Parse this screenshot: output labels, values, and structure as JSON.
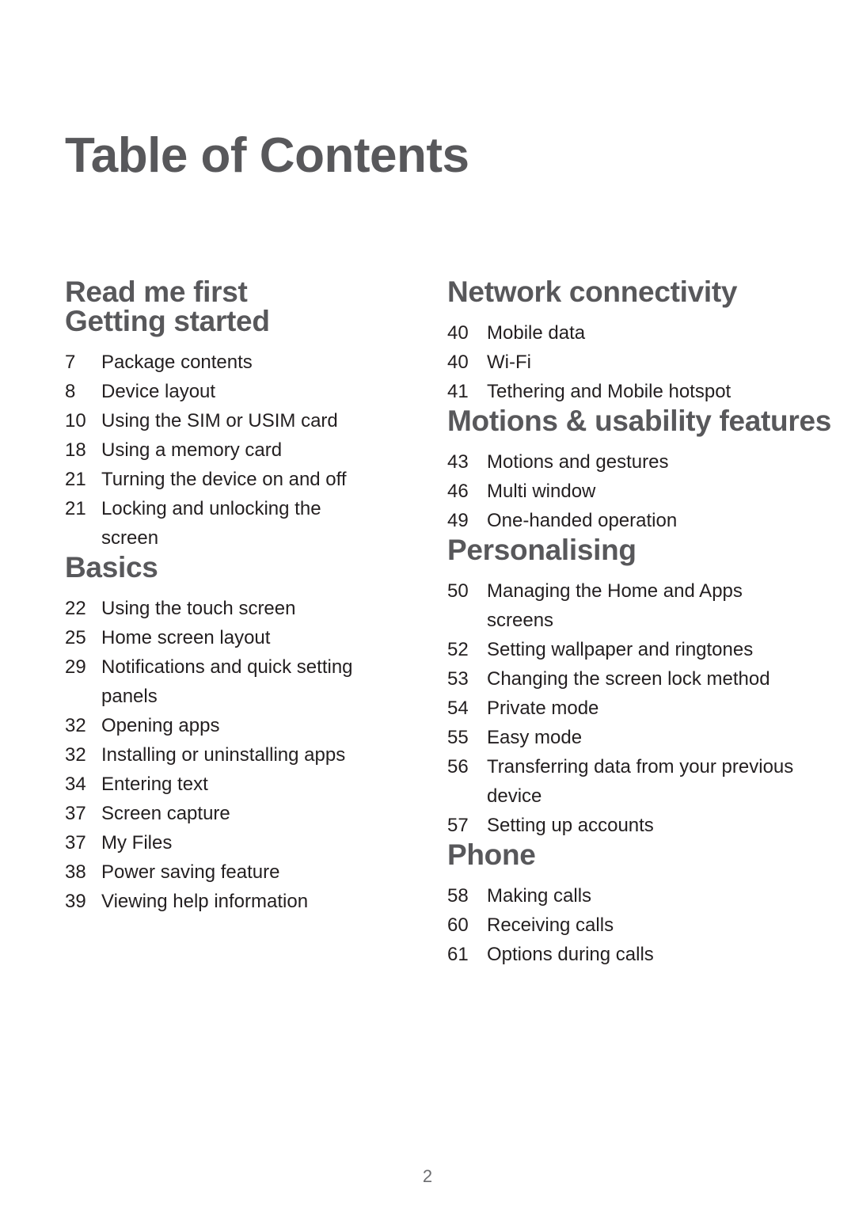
{
  "document": {
    "title": "Table of Contents",
    "page_number": "2",
    "heading_color": "#58585B",
    "body_color": "#231F20",
    "page_number_color": "#6D6E71",
    "background_color": "#FFFFFF"
  },
  "columns": {
    "left": [
      {
        "heading": "Read me first",
        "entries": []
      },
      {
        "heading": "Getting started",
        "entries": [
          {
            "page": "7",
            "label": "Package contents"
          },
          {
            "page": "8",
            "label": "Device layout"
          },
          {
            "page": "10",
            "label": "Using the SIM or USIM card"
          },
          {
            "page": "18",
            "label": "Using a memory card"
          },
          {
            "page": "21",
            "label": "Turning the device on and off"
          },
          {
            "page": "21",
            "label": "Locking and unlocking the screen"
          }
        ]
      },
      {
        "heading": "Basics",
        "entries": [
          {
            "page": "22",
            "label": "Using the touch screen"
          },
          {
            "page": "25",
            "label": "Home screen layout"
          },
          {
            "page": "29",
            "label": "Notifications and quick setting panels"
          },
          {
            "page": "32",
            "label": "Opening apps"
          },
          {
            "page": "32",
            "label": "Installing or uninstalling apps"
          },
          {
            "page": "34",
            "label": "Entering text"
          },
          {
            "page": "37",
            "label": "Screen capture"
          },
          {
            "page": "37",
            "label": "My Files"
          },
          {
            "page": "38",
            "label": "Power saving feature"
          },
          {
            "page": "39",
            "label": "Viewing help information"
          }
        ]
      }
    ],
    "right": [
      {
        "heading": "Network connectivity",
        "entries": [
          {
            "page": "40",
            "label": "Mobile data"
          },
          {
            "page": "40",
            "label": "Wi-Fi"
          },
          {
            "page": "41",
            "label": "Tethering and Mobile hotspot"
          }
        ]
      },
      {
        "heading": "Motions & usability features",
        "entries": [
          {
            "page": "43",
            "label": "Motions and gestures"
          },
          {
            "page": "46",
            "label": "Multi window"
          },
          {
            "page": "49",
            "label": "One-handed operation"
          }
        ]
      },
      {
        "heading": "Personalising",
        "entries": [
          {
            "page": "50",
            "label": "Managing the Home and Apps screens"
          },
          {
            "page": "52",
            "label": "Setting wallpaper and ringtones"
          },
          {
            "page": "53",
            "label": "Changing the screen lock method"
          },
          {
            "page": "54",
            "label": "Private mode"
          },
          {
            "page": "55",
            "label": "Easy mode"
          },
          {
            "page": "56",
            "label": "Transferring data from your previous device"
          },
          {
            "page": "57",
            "label": "Setting up accounts"
          }
        ]
      },
      {
        "heading": "Phone",
        "entries": [
          {
            "page": "58",
            "label": "Making calls"
          },
          {
            "page": "60",
            "label": "Receiving calls"
          },
          {
            "page": "61",
            "label": "Options during calls"
          }
        ]
      }
    ]
  }
}
